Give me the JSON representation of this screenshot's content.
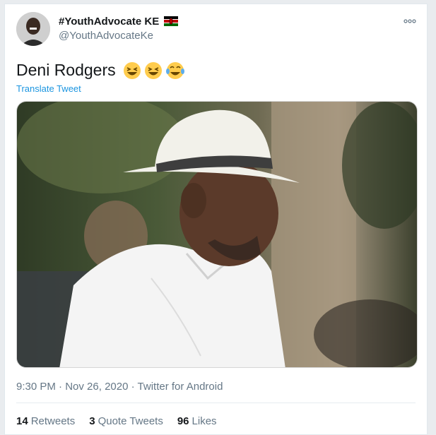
{
  "header": {
    "display_name": "#YouthAdvocate KE",
    "handle": "@YouthAdvocateKe"
  },
  "icons": {
    "more": "more-options-icon",
    "flag": "kenya-flag-icon",
    "emoji_laugh": "grinning-squinting-face",
    "emoji_tears": "face-with-tears-of-joy"
  },
  "tweet": {
    "text": "Deni Rodgers",
    "translate_label": "Translate Tweet",
    "photo_subject": "man in white hat and white shirt"
  },
  "meta": {
    "time": "9:30 PM",
    "separator": "·",
    "date": "Nov 26, 2020",
    "source": "Twitter for Android"
  },
  "stats": {
    "retweets_count": "14",
    "retweets_label": "Retweets",
    "quotes_count": "3",
    "quotes_label": "Quote Tweets",
    "likes_count": "96",
    "likes_label": "Likes"
  },
  "colors": {
    "link": "#1b95e0",
    "secondary_text": "#657786",
    "primary_text": "#14171a"
  }
}
